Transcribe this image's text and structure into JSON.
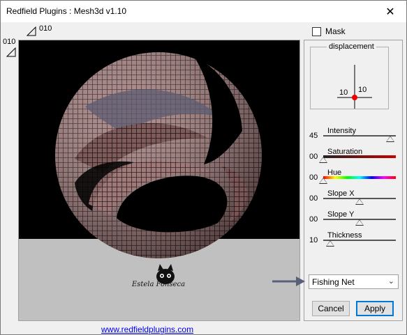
{
  "window": {
    "title": "Redfield Plugins : Mesh3d v1.10",
    "close_label": "✕"
  },
  "markers": {
    "top": "010",
    "left": "010"
  },
  "mask": {
    "label": "Mask",
    "checked": false
  },
  "displacement": {
    "legend": "displacement",
    "x": "10",
    "y": "10"
  },
  "sliders": [
    {
      "label": "Intensity",
      "value": "45",
      "fraction": 0.92
    },
    {
      "label": "Saturation",
      "value": "00",
      "fraction": 0.0
    },
    {
      "label": "Hue",
      "value": "00",
      "fraction": 0.0
    },
    {
      "label": "Slope X",
      "value": "00",
      "fraction": 0.5
    },
    {
      "label": "Slope Y",
      "value": "00",
      "fraction": 0.5
    },
    {
      "label": "Thickness",
      "value": "10",
      "fraction": 0.1
    }
  ],
  "pattern": {
    "selected": "Fishing Net"
  },
  "buttons": {
    "cancel": "Cancel",
    "apply": "Apply"
  },
  "link": "www.redfieldplugins.com",
  "watermark": "Estela Fonseca",
  "colors": {
    "mesh": "#a07878",
    "mesh_dark": "#3a2626",
    "apply_border": "#0078d7",
    "arrow": "#5a5f7a"
  }
}
